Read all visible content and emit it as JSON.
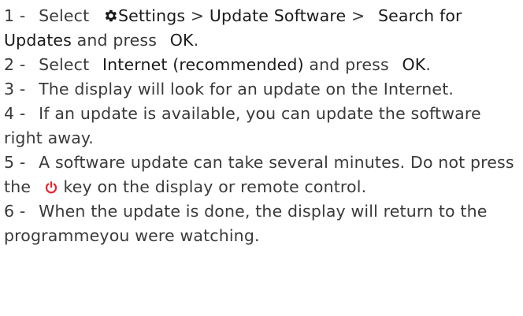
{
  "steps": [
    {
      "number": "1",
      "separator": "-",
      "parts": {
        "t1": "Select",
        "icon": "gear-icon",
        "settings": "Settings",
        "gt1": ">",
        "update_software": "Update Software",
        "gt2": ">",
        "search_for_updates": "Search for Updates",
        "t2": "and press",
        "ok": "OK",
        "end": "."
      }
    },
    {
      "number": "2",
      "separator": "-",
      "parts": {
        "t1": "Select",
        "internet": "Internet (recommended)",
        "t2": "and press",
        "ok": "OK",
        "end": "."
      }
    },
    {
      "number": "3",
      "separator": "-",
      "text": "The display will look for an update on the Internet."
    },
    {
      "number": "4",
      "separator": "-",
      "text": "If an update is available, you can update the software right away."
    },
    {
      "number": "5",
      "separator": "-",
      "parts": {
        "t1": "A software update can take several minutes. Do not press the",
        "icon": "power-icon",
        "t2": "key on the display or remote control."
      }
    },
    {
      "number": "6",
      "separator": "-",
      "text": "When the update is done, the display will return to the programmeyou were watching."
    }
  ],
  "colors": {
    "text": "#3a3a3a",
    "keyword": "#1a1a1a",
    "power_icon": "#e8242c"
  }
}
